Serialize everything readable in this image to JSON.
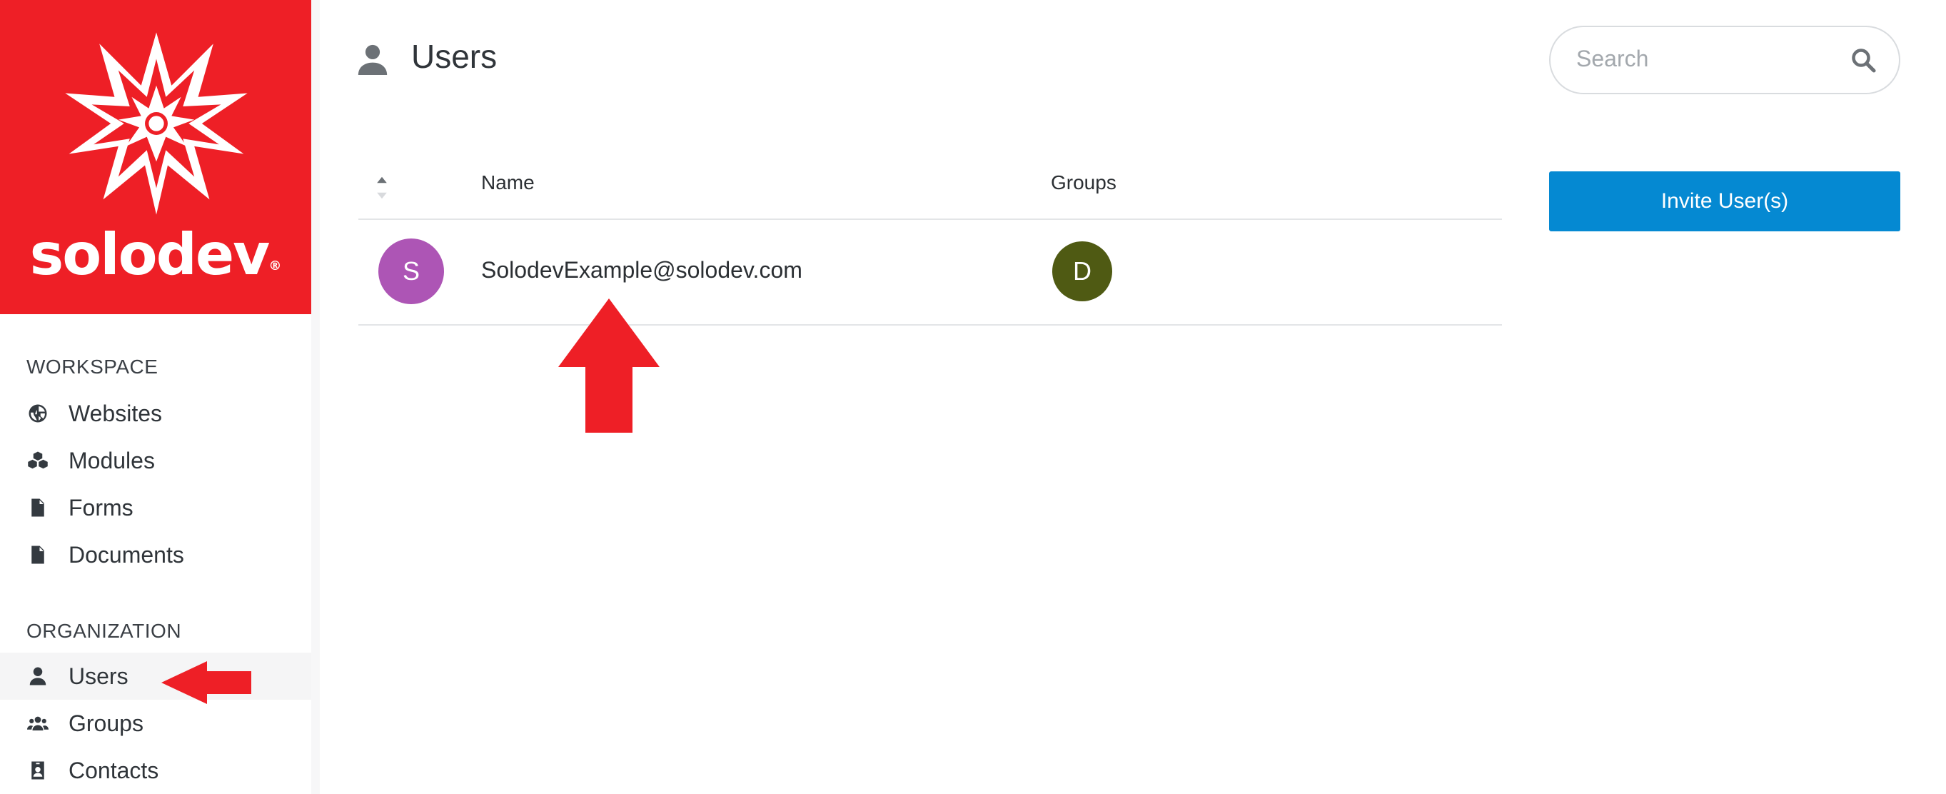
{
  "brand": {
    "name": "solodev",
    "registered_mark": "®",
    "color": "#ee1f26"
  },
  "sidebar": {
    "sections": [
      {
        "label": "WORKSPACE",
        "items": [
          {
            "label": "Websites",
            "icon": "globe-icon"
          },
          {
            "label": "Modules",
            "icon": "cubes-icon"
          },
          {
            "label": "Forms",
            "icon": "form-document-icon"
          },
          {
            "label": "Documents",
            "icon": "document-icon"
          }
        ]
      },
      {
        "label": "ORGANIZATION",
        "items": [
          {
            "label": "Users",
            "icon": "user-icon",
            "active": true
          },
          {
            "label": "Groups",
            "icon": "users-group-icon"
          },
          {
            "label": "Contacts",
            "icon": "contact-card-icon"
          }
        ]
      }
    ]
  },
  "header": {
    "title": "Users",
    "icon": "user-icon"
  },
  "search": {
    "placeholder": "Search",
    "icon": "search-icon"
  },
  "actions": {
    "invite_label": "Invite User(s)",
    "invite_color": "#0589d2"
  },
  "table": {
    "columns": [
      "Name",
      "Groups"
    ],
    "sort_icon": "sort-icon",
    "rows": [
      {
        "avatar_initial": "S",
        "avatar_color": "#ad55b5",
        "name": "SolodevExample@solodev.com",
        "groups": [
          {
            "initial": "D",
            "color": "#4f5a13"
          }
        ]
      }
    ]
  },
  "annotations": {
    "arrow_color": "#ee1f26"
  }
}
